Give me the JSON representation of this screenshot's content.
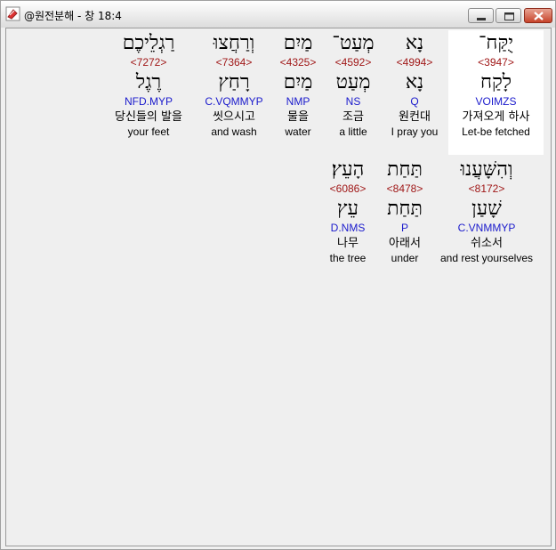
{
  "window": {
    "title": "@원전분해 - 창 18:4"
  },
  "rows": [
    {
      "words": [
        {
          "hebrew": "יֻקַּח־",
          "strong": "<3947>",
          "lexeme": "לָקַח",
          "morph": "VOIMZS",
          "korean": "가져오게 하사",
          "english": "Let-be fetched",
          "selected": true
        },
        {
          "hebrew": "נָא",
          "strong": "<4994>",
          "lexeme": "נָא",
          "morph": "Q",
          "korean": "원컨대",
          "english": "I pray you"
        },
        {
          "hebrew": "מְעַט־",
          "strong": "<4592>",
          "lexeme": "מְעַט",
          "morph": "NS",
          "korean": "조금",
          "english": "a little"
        },
        {
          "hebrew": "מַיִם",
          "strong": "<4325>",
          "lexeme": "מַיִם",
          "morph": "NMP",
          "korean": "물을",
          "english": "water"
        },
        {
          "hebrew": "וְרַחֲצוּ",
          "strong": "<7364>",
          "lexeme": "רָחַץ",
          "morph": "C.VQMMYP",
          "korean": "씻으시고",
          "english": "and wash"
        },
        {
          "hebrew": "רַגְלֵיכֶם",
          "strong": "<7272>",
          "lexeme": "רֶגֶל",
          "morph": "NFD.MYP",
          "korean": "당신들의 발을",
          "english": "your feet"
        }
      ]
    },
    {
      "words": [
        {
          "hebrew": "וְהִשָּׁעֲנוּ",
          "strong": "<8172>",
          "lexeme": "שָׁעַן",
          "morph": "C.VNMMYP",
          "korean": "쉬소서",
          "english": "and rest yourselves"
        },
        {
          "hebrew": "תַּחַת",
          "strong": "<8478>",
          "lexeme": "תַּחַת",
          "morph": "P",
          "korean": "아래서",
          "english": "under"
        },
        {
          "hebrew": "הָעֵץ׃",
          "strong": "<6086>",
          "lexeme": "עֵץ",
          "morph": "D.NMS",
          "korean": "나무",
          "english": "the tree"
        }
      ]
    }
  ]
}
